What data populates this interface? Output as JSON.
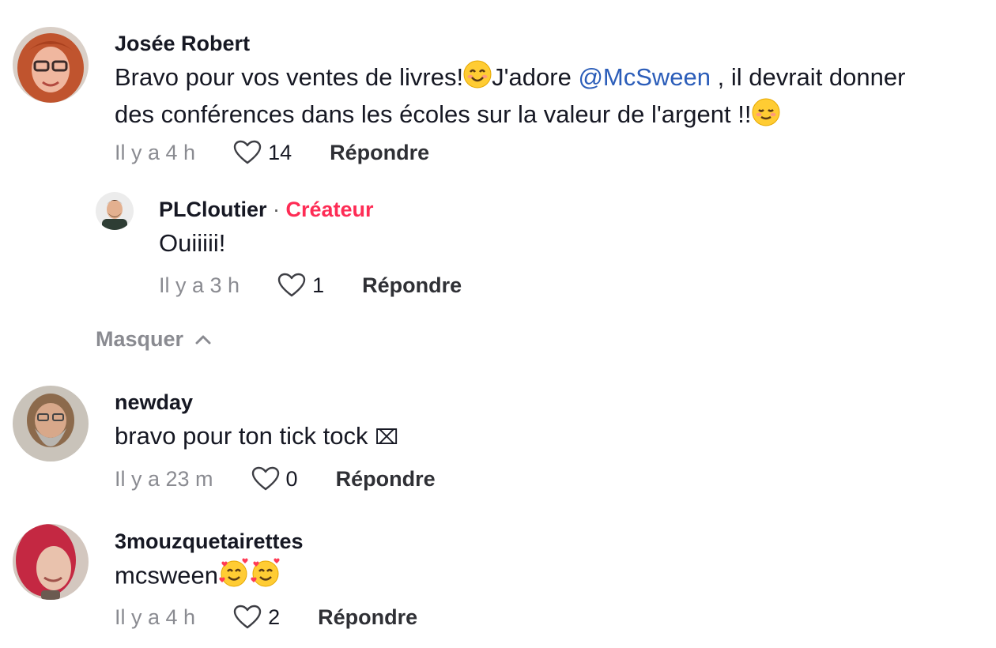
{
  "comments": [
    {
      "username": "Josée Robert",
      "text_line1_a": "Bravo pour vos ventes de livres!",
      "text_line1_b": "J'adore ",
      "mention": "@McSween",
      "text_line1_c": " , il devrait donner",
      "text_line2": "des conférences dans les écoles sur la valeur de l'argent !!",
      "time": "Il y a 4 h",
      "likes": "14",
      "reply_label": "Répondre",
      "emojis": [
        "smiling-face-emoji",
        "relieved-face-emoji"
      ],
      "reply": {
        "username": "PLCloutier",
        "separator": " · ",
        "badge": "Créateur",
        "text": "Ouiiiii!",
        "time": "Il y a 3 h",
        "likes": "1",
        "reply_label": "Répondre"
      }
    },
    {
      "username": "newday",
      "text": "bravo pour ton tick tock ",
      "missing_glyph": "⌧",
      "time": "Il y a 23 m",
      "likes": "0",
      "reply_label": "Répondre"
    },
    {
      "username": "3mouzquetairettes",
      "text": "mcsween",
      "emojis": [
        "smiling-face-with-hearts-emoji",
        "smiling-face-with-hearts-emoji"
      ],
      "time": "Il y a 4 h",
      "likes": "2",
      "reply_label": "Répondre"
    }
  ],
  "collapse_label": "Masquer",
  "colors": {
    "text": "#161823",
    "muted": "#8a8b91",
    "mention": "#2b5db9",
    "creator": "#fe2c55"
  },
  "icons": [
    "heart-outline-icon",
    "chevron-up-icon"
  ]
}
